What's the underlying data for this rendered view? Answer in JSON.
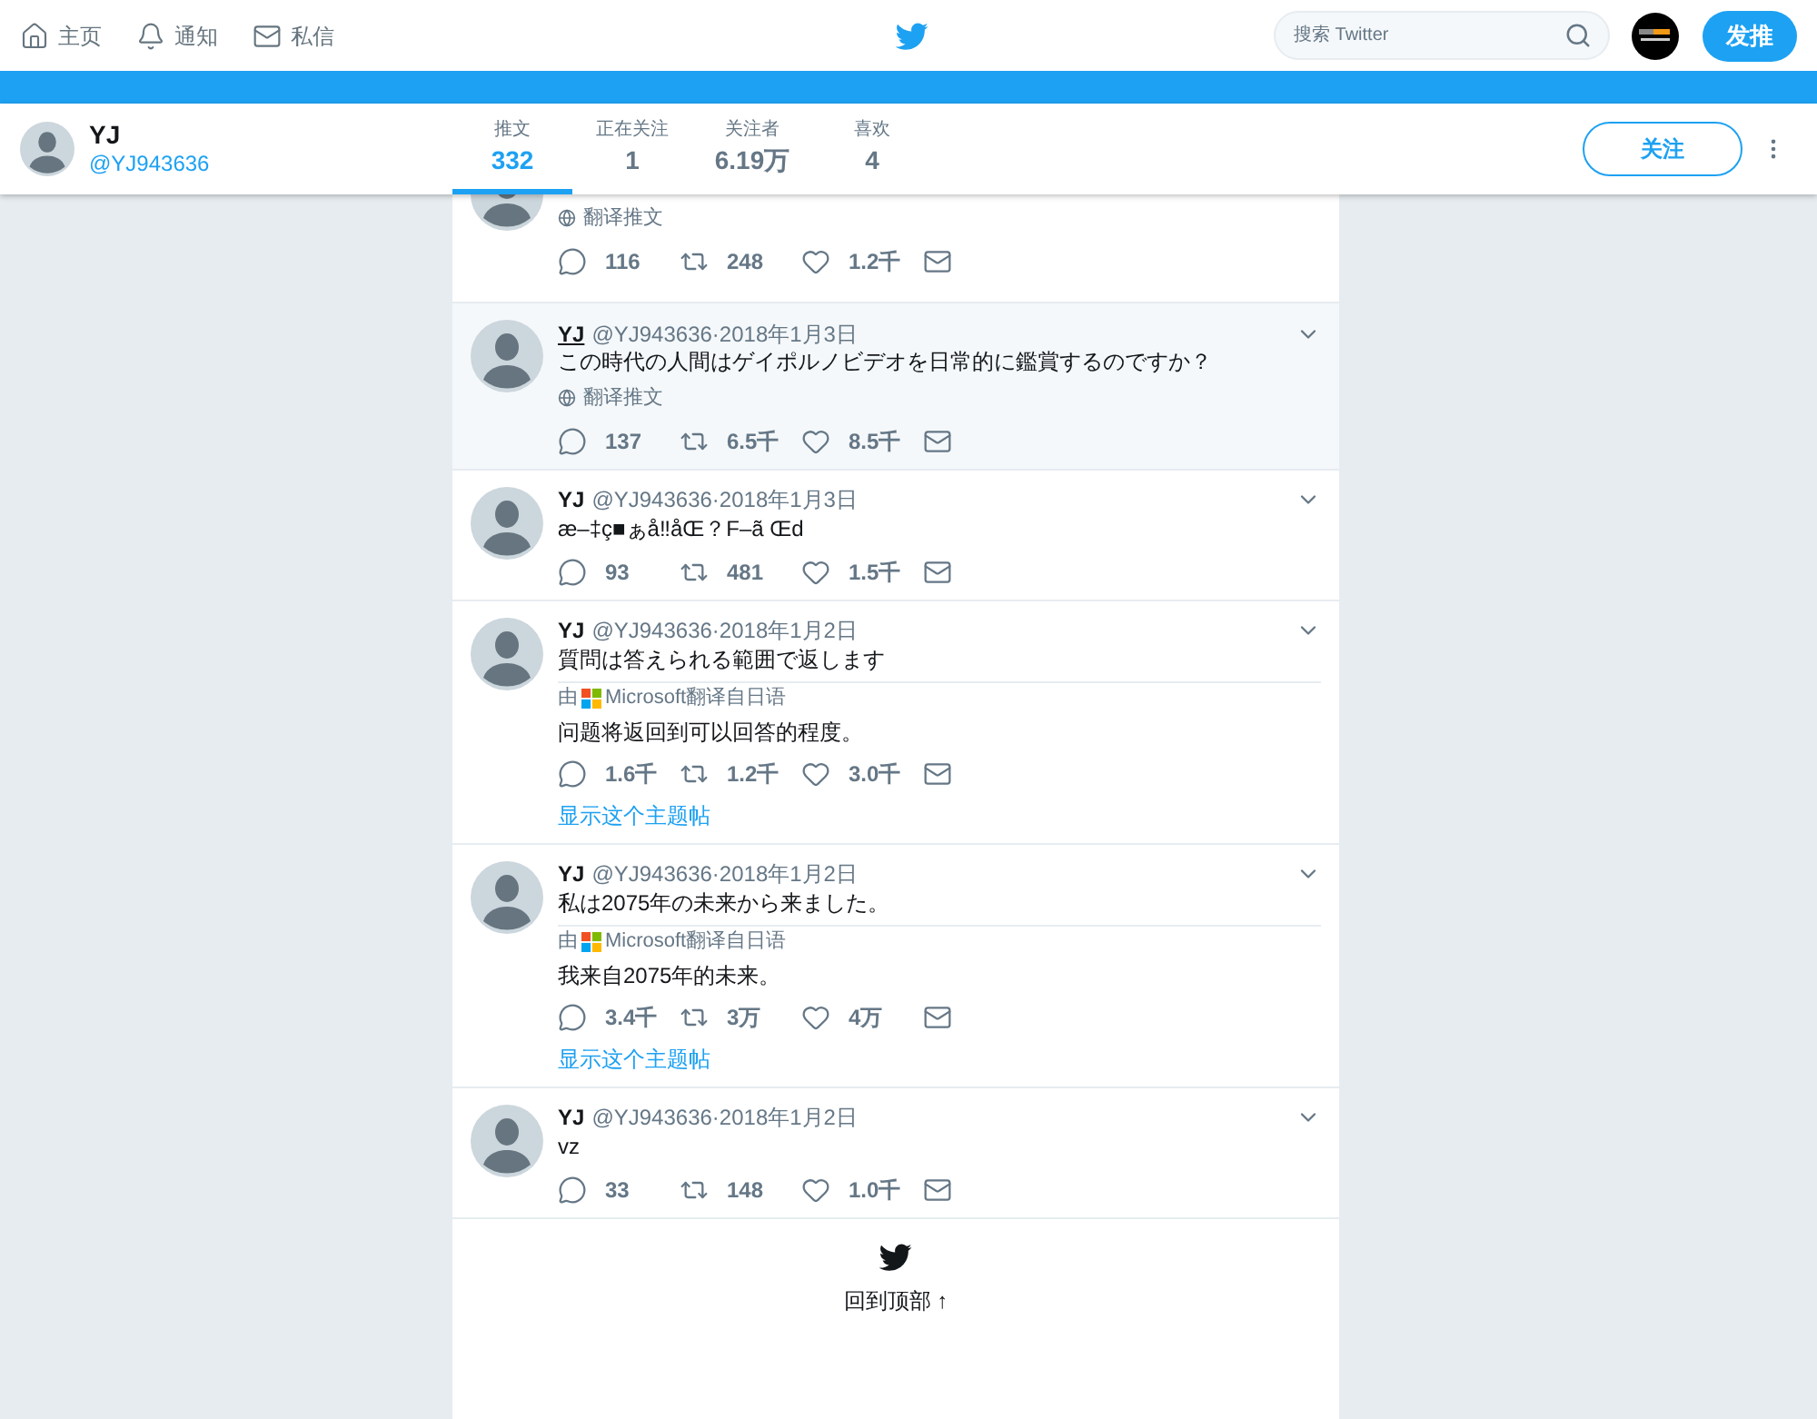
{
  "nav": [
    {
      "kind": "home",
      "label": "主页"
    },
    {
      "kind": "bell",
      "label": "通知"
    },
    {
      "kind": "mail",
      "label": "私信"
    }
  ],
  "search": {
    "placeholder": "搜索 Twitter"
  },
  "compose_button": "发推",
  "profile": {
    "name": "YJ",
    "handle": "@YJ943636"
  },
  "stats": [
    {
      "label": "推文",
      "value": "332",
      "selected": true
    },
    {
      "label": "正在关注",
      "value": "1",
      "selected": false
    },
    {
      "label": "关注者",
      "value": "6.19万",
      "selected": false
    },
    {
      "label": "喜欢",
      "value": "4",
      "selected": false
    }
  ],
  "follow_button": "关注",
  "tweets": [
    {
      "kind": "partial",
      "translate_label": "翻译推文",
      "reply": "116",
      "retweet": "248",
      "like": "1.2千"
    },
    {
      "kind": "full",
      "hovered": true,
      "name": "YJ",
      "handle": "@YJ943636",
      "date": "·2018年1月3日",
      "text": "この時代の人間はゲイポルノビデオを日常的に鑑賞するのですか？",
      "translate_label": "翻译推文",
      "reply": "137",
      "retweet": "6.5千",
      "like": "8.5千"
    },
    {
      "kind": "full",
      "hovered": false,
      "name": "YJ",
      "handle": "@YJ943636",
      "date": "·2018年1月3日",
      "text": "æ–‡ç■ぁå‼åŒ？F–ã Œd",
      "reply": "93",
      "retweet": "481",
      "like": "1.5千"
    },
    {
      "kind": "full",
      "hovered": false,
      "name": "YJ",
      "handle": "@YJ943636",
      "date": "·2018年1月2日",
      "text": "質問は答えられる範囲で返します",
      "translation": {
        "prefix": "由",
        "source": "Microsoft翻译自日语",
        "text": "问题将返回到可以回答的程度。"
      },
      "reply": "1.6千",
      "retweet": "1.2千",
      "like": "3.0千",
      "thread_link": "显示这个主题帖"
    },
    {
      "kind": "full",
      "hovered": false,
      "name": "YJ",
      "handle": "@YJ943636",
      "date": "·2018年1月2日",
      "text": "私は2075年の未来から来ました。",
      "translation": {
        "prefix": "由",
        "source": "Microsoft翻译自日语",
        "text": "我来自2075年的未来。"
      },
      "reply": "3.4千",
      "retweet": "3万",
      "like": "4万",
      "thread_link": "显示这个主题帖"
    },
    {
      "kind": "full",
      "hovered": false,
      "name": "YJ",
      "handle": "@YJ943636",
      "date": "·2018年1月2日",
      "text": "vz",
      "reply": "33",
      "retweet": "148",
      "like": "1.0千"
    }
  ],
  "back_to_top": "回到顶部 ↑"
}
